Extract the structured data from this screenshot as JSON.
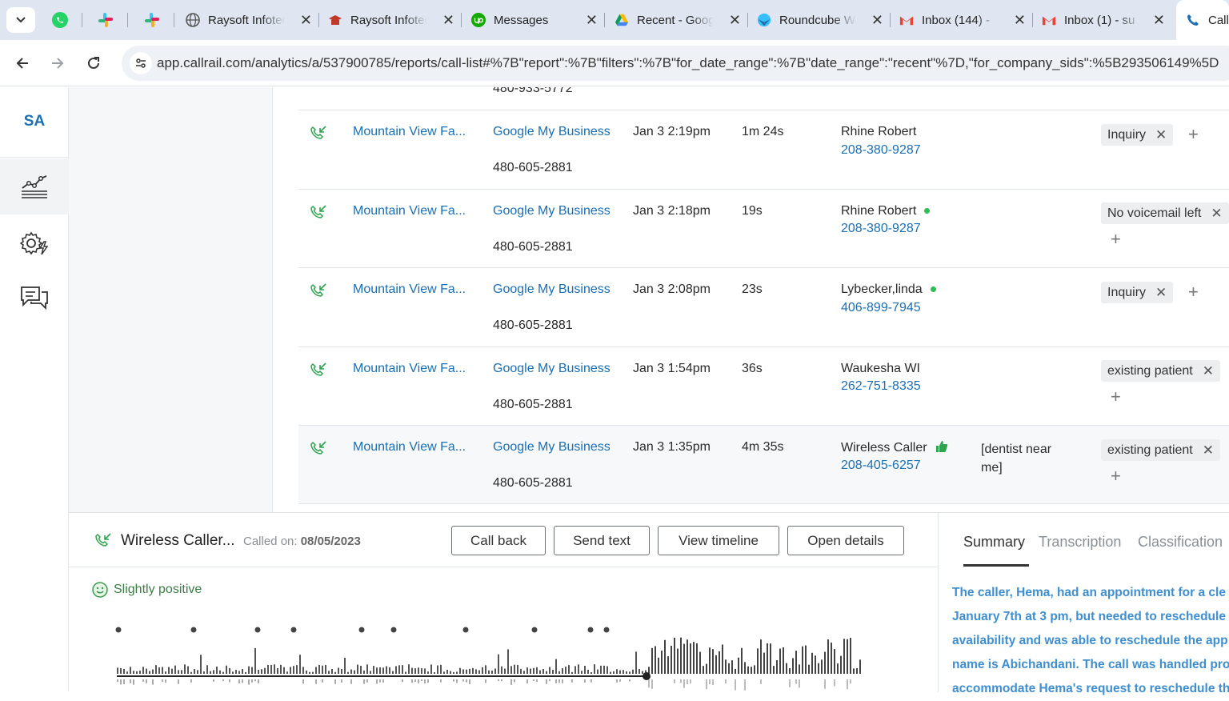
{
  "browser": {
    "tabs": [
      {
        "title": "Raysoft Infotech",
        "icon": "globe-icon"
      },
      {
        "title": "Raysoft Infotech",
        "icon": "school-icon"
      },
      {
        "title": "Messages",
        "icon": "upwork-icon"
      },
      {
        "title": "Recent - Google Drive",
        "icon": "drive-icon"
      },
      {
        "title": "Roundcube Webmail",
        "icon": "roundcube-icon"
      },
      {
        "title": "Inbox (144) -",
        "icon": "gmail-icon"
      },
      {
        "title": "Inbox (1) - su",
        "icon": "gmail-icon"
      },
      {
        "title": "Call",
        "icon": "phone-icon"
      }
    ],
    "url": "app.callrail.com/analytics/a/537900785/reports/call-list#%7B\"report\":%7B\"filters\":%7B\"for_date_range\":%7B\"date_range\":\"recent\"%7D,\"for_company_sids\":%5B293506149%5D"
  },
  "sidebar": {
    "logo": "SA"
  },
  "table": {
    "partial_row_number": "480-933-5772",
    "rows": [
      {
        "source_name": "Mountain View Fa...",
        "source": "Google My Business",
        "tracking_number": "480-605-2881",
        "date": "Jan 3 2:19pm",
        "duration": "1m 24s",
        "caller": "Rhine Robert",
        "caller_phone": "208-380-9287",
        "online": false,
        "keywords": "",
        "tag": "Inquiry"
      },
      {
        "source_name": "Mountain View Fa...",
        "source": "Google My Business",
        "tracking_number": "480-605-2881",
        "date": "Jan 3 2:18pm",
        "duration": "19s",
        "caller": "Rhine Robert",
        "caller_phone": "208-380-9287",
        "online": true,
        "keywords": "",
        "tag": "No voicemail left"
      },
      {
        "source_name": "Mountain View Fa...",
        "source": "Google My Business",
        "tracking_number": "480-605-2881",
        "date": "Jan 3 2:08pm",
        "duration": "23s",
        "caller": "Lybecker,linda",
        "caller_phone": "406-899-7945",
        "online": true,
        "keywords": "",
        "tag": "Inquiry"
      },
      {
        "source_name": "Mountain View Fa...",
        "source": "Google My Business",
        "tracking_number": "480-605-2881",
        "date": "Jan 3 1:54pm",
        "duration": "36s",
        "caller": "Waukesha WI",
        "caller_phone": "262-751-8335",
        "online": false,
        "keywords": "",
        "tag": "existing patient"
      },
      {
        "source_name": "Mountain View Fa...",
        "source": "Google My Business",
        "tracking_number": "480-605-2881",
        "date": "Jan 3 1:35pm",
        "duration": "4m 35s",
        "caller": "Wireless Caller",
        "caller_phone": "208-405-6257",
        "online": false,
        "thumbs_up": true,
        "keywords": "[dentist near me]",
        "tag": "existing patient"
      }
    ]
  },
  "panel": {
    "caller_name": "Wireless Caller...",
    "called_on_label": "Called on:",
    "called_on_date": "08/05/2023",
    "buttons": {
      "call_back": "Call back",
      "send_text": "Send text",
      "view_timeline": "View timeline",
      "open_details": "Open details"
    },
    "sentiment": "Slightly positive",
    "tabs": {
      "summary": "Summary",
      "transcription": "Transcription",
      "classification": "Classification"
    },
    "summary_lines": [
      "The caller, Hema, had an appointment for a cle",
      "January 7th at 3 pm, but needed to reschedule",
      "availability and was able to reschedule the app",
      "name is Abichandani. The call was handled pro",
      "accommodate Hema's request to reschedule th"
    ]
  },
  "colors": {
    "link": "#1b6fb5",
    "online_dot": "#2ebd55",
    "sentiment": "#3a7d44",
    "summary": "#3e8ed0"
  }
}
